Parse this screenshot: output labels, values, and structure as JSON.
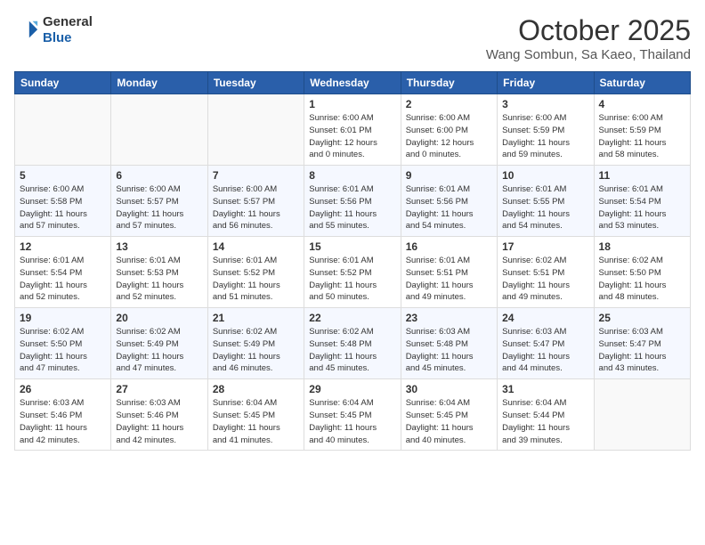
{
  "header": {
    "logo": {
      "line1": "General",
      "line2": "Blue"
    },
    "title": "October 2025",
    "location": "Wang Sombun, Sa Kaeo, Thailand"
  },
  "weekdays": [
    "Sunday",
    "Monday",
    "Tuesday",
    "Wednesday",
    "Thursday",
    "Friday",
    "Saturday"
  ],
  "weeks": [
    [
      {
        "day": "",
        "info": ""
      },
      {
        "day": "",
        "info": ""
      },
      {
        "day": "",
        "info": ""
      },
      {
        "day": "1",
        "info": "Sunrise: 6:00 AM\nSunset: 6:01 PM\nDaylight: 12 hours\nand 0 minutes."
      },
      {
        "day": "2",
        "info": "Sunrise: 6:00 AM\nSunset: 6:00 PM\nDaylight: 12 hours\nand 0 minutes."
      },
      {
        "day": "3",
        "info": "Sunrise: 6:00 AM\nSunset: 5:59 PM\nDaylight: 11 hours\nand 59 minutes."
      },
      {
        "day": "4",
        "info": "Sunrise: 6:00 AM\nSunset: 5:59 PM\nDaylight: 11 hours\nand 58 minutes."
      }
    ],
    [
      {
        "day": "5",
        "info": "Sunrise: 6:00 AM\nSunset: 5:58 PM\nDaylight: 11 hours\nand 57 minutes."
      },
      {
        "day": "6",
        "info": "Sunrise: 6:00 AM\nSunset: 5:57 PM\nDaylight: 11 hours\nand 57 minutes."
      },
      {
        "day": "7",
        "info": "Sunrise: 6:00 AM\nSunset: 5:57 PM\nDaylight: 11 hours\nand 56 minutes."
      },
      {
        "day": "8",
        "info": "Sunrise: 6:01 AM\nSunset: 5:56 PM\nDaylight: 11 hours\nand 55 minutes."
      },
      {
        "day": "9",
        "info": "Sunrise: 6:01 AM\nSunset: 5:56 PM\nDaylight: 11 hours\nand 54 minutes."
      },
      {
        "day": "10",
        "info": "Sunrise: 6:01 AM\nSunset: 5:55 PM\nDaylight: 11 hours\nand 54 minutes."
      },
      {
        "day": "11",
        "info": "Sunrise: 6:01 AM\nSunset: 5:54 PM\nDaylight: 11 hours\nand 53 minutes."
      }
    ],
    [
      {
        "day": "12",
        "info": "Sunrise: 6:01 AM\nSunset: 5:54 PM\nDaylight: 11 hours\nand 52 minutes."
      },
      {
        "day": "13",
        "info": "Sunrise: 6:01 AM\nSunset: 5:53 PM\nDaylight: 11 hours\nand 52 minutes."
      },
      {
        "day": "14",
        "info": "Sunrise: 6:01 AM\nSunset: 5:52 PM\nDaylight: 11 hours\nand 51 minutes."
      },
      {
        "day": "15",
        "info": "Sunrise: 6:01 AM\nSunset: 5:52 PM\nDaylight: 11 hours\nand 50 minutes."
      },
      {
        "day": "16",
        "info": "Sunrise: 6:01 AM\nSunset: 5:51 PM\nDaylight: 11 hours\nand 49 minutes."
      },
      {
        "day": "17",
        "info": "Sunrise: 6:02 AM\nSunset: 5:51 PM\nDaylight: 11 hours\nand 49 minutes."
      },
      {
        "day": "18",
        "info": "Sunrise: 6:02 AM\nSunset: 5:50 PM\nDaylight: 11 hours\nand 48 minutes."
      }
    ],
    [
      {
        "day": "19",
        "info": "Sunrise: 6:02 AM\nSunset: 5:50 PM\nDaylight: 11 hours\nand 47 minutes."
      },
      {
        "day": "20",
        "info": "Sunrise: 6:02 AM\nSunset: 5:49 PM\nDaylight: 11 hours\nand 47 minutes."
      },
      {
        "day": "21",
        "info": "Sunrise: 6:02 AM\nSunset: 5:49 PM\nDaylight: 11 hours\nand 46 minutes."
      },
      {
        "day": "22",
        "info": "Sunrise: 6:02 AM\nSunset: 5:48 PM\nDaylight: 11 hours\nand 45 minutes."
      },
      {
        "day": "23",
        "info": "Sunrise: 6:03 AM\nSunset: 5:48 PM\nDaylight: 11 hours\nand 45 minutes."
      },
      {
        "day": "24",
        "info": "Sunrise: 6:03 AM\nSunset: 5:47 PM\nDaylight: 11 hours\nand 44 minutes."
      },
      {
        "day": "25",
        "info": "Sunrise: 6:03 AM\nSunset: 5:47 PM\nDaylight: 11 hours\nand 43 minutes."
      }
    ],
    [
      {
        "day": "26",
        "info": "Sunrise: 6:03 AM\nSunset: 5:46 PM\nDaylight: 11 hours\nand 42 minutes."
      },
      {
        "day": "27",
        "info": "Sunrise: 6:03 AM\nSunset: 5:46 PM\nDaylight: 11 hours\nand 42 minutes."
      },
      {
        "day": "28",
        "info": "Sunrise: 6:04 AM\nSunset: 5:45 PM\nDaylight: 11 hours\nand 41 minutes."
      },
      {
        "day": "29",
        "info": "Sunrise: 6:04 AM\nSunset: 5:45 PM\nDaylight: 11 hours\nand 40 minutes."
      },
      {
        "day": "30",
        "info": "Sunrise: 6:04 AM\nSunset: 5:45 PM\nDaylight: 11 hours\nand 40 minutes."
      },
      {
        "day": "31",
        "info": "Sunrise: 6:04 AM\nSunset: 5:44 PM\nDaylight: 11 hours\nand 39 minutes."
      },
      {
        "day": "",
        "info": ""
      }
    ]
  ]
}
